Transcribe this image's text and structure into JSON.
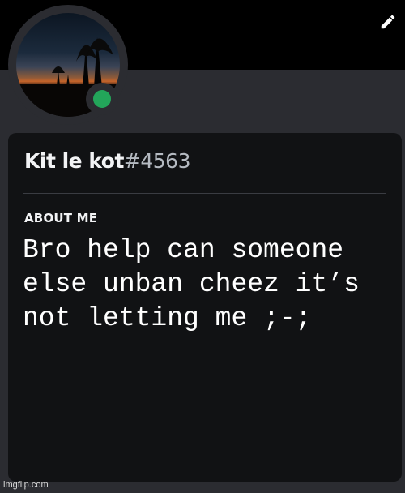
{
  "profile": {
    "display_name": "Kit le kot",
    "discriminator": "#4563",
    "status": "online",
    "status_color": "#23a55a"
  },
  "about": {
    "heading": "ABOUT ME",
    "text": "Bro help can someone else unban cheez it’s not letting me ;-;"
  },
  "icons": {
    "edit": "pencil-icon"
  },
  "watermark": "imgflip.com"
}
